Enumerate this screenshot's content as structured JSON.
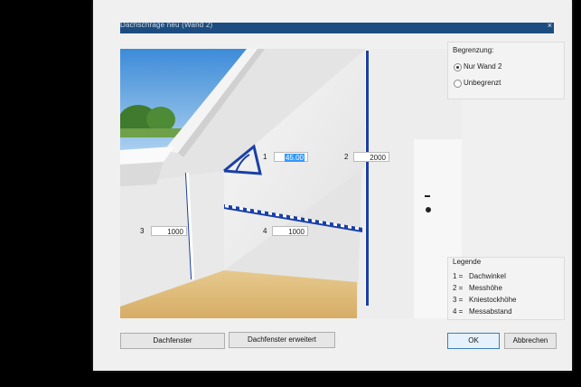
{
  "dialog": {
    "title": "Dachschräge neu (Wand 2)",
    "close": "×"
  },
  "begrenzung": {
    "label": "Begrenzung:",
    "options": [
      {
        "label": "Nur Wand 2",
        "selected": true
      },
      {
        "label": "Unbegrenzt",
        "selected": false
      }
    ]
  },
  "fields": {
    "f1": {
      "num": "1",
      "value": "45.00"
    },
    "f2": {
      "num": "2",
      "value": "2000"
    },
    "f3": {
      "num": "3",
      "value": "1000"
    },
    "f4": {
      "num": "4",
      "value": "1000"
    }
  },
  "legend": {
    "title": "Legende",
    "items": [
      {
        "key": "1 =",
        "text": "Dachwinkel"
      },
      {
        "key": "2 =",
        "text": "Messhöhe"
      },
      {
        "key": "3 =",
        "text": "Kniestockhöhe"
      },
      {
        "key": "4 =",
        "text": "Messabstand"
      }
    ]
  },
  "buttons": {
    "dachfenster": "Dachfenster",
    "dachfenster_erweitert": "Dachfenster erweitert",
    "ok": "OK",
    "abbrechen": "Abbrechen"
  },
  "colors": {
    "titlebar": "#1d4d80",
    "measure_blue": "#1a3fa6",
    "selection": "#3399ff"
  }
}
